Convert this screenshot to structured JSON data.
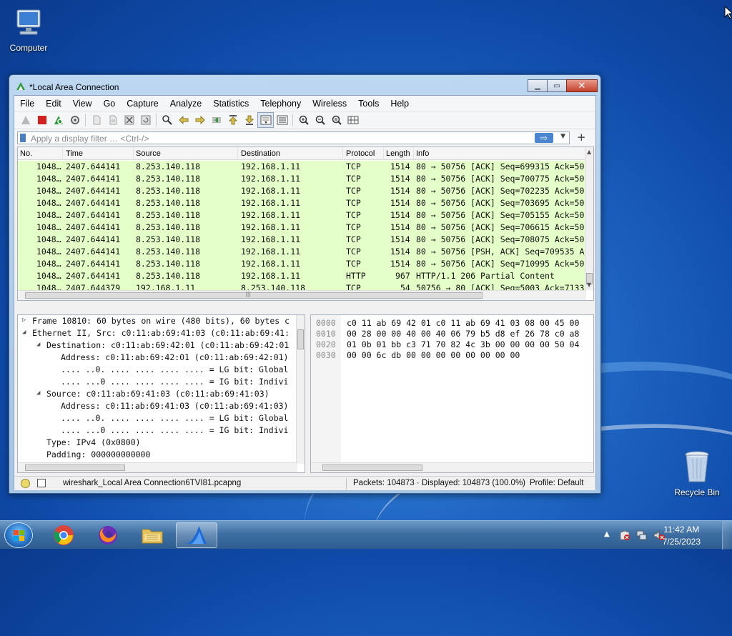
{
  "desktop": {
    "icons": [
      {
        "label": "Computer"
      },
      {
        "label": "Recycle Bin"
      }
    ]
  },
  "window": {
    "title": "*Local Area Connection",
    "menu": [
      "File",
      "Edit",
      "View",
      "Go",
      "Capture",
      "Analyze",
      "Statistics",
      "Telephony",
      "Wireless",
      "Tools",
      "Help"
    ],
    "filter_placeholder": "Apply a display filter … <Ctrl-/>",
    "columns": [
      "No.",
      "Time",
      "Source",
      "Destination",
      "Protocol",
      "Length",
      "Info"
    ],
    "packets": [
      {
        "no": "1048…",
        "time": "2407.644141",
        "src": "8.253.140.118",
        "dst": "192.168.1.11",
        "proto": "TCP",
        "len": "1514",
        "info": "80 → 50756 [ACK] Seq=699315 Ack=50"
      },
      {
        "no": "1048…",
        "time": "2407.644141",
        "src": "8.253.140.118",
        "dst": "192.168.1.11",
        "proto": "TCP",
        "len": "1514",
        "info": "80 → 50756 [ACK] Seq=700775 Ack=50"
      },
      {
        "no": "1048…",
        "time": "2407.644141",
        "src": "8.253.140.118",
        "dst": "192.168.1.11",
        "proto": "TCP",
        "len": "1514",
        "info": "80 → 50756 [ACK] Seq=702235 Ack=50"
      },
      {
        "no": "1048…",
        "time": "2407.644141",
        "src": "8.253.140.118",
        "dst": "192.168.1.11",
        "proto": "TCP",
        "len": "1514",
        "info": "80 → 50756 [ACK] Seq=703695 Ack=50"
      },
      {
        "no": "1048…",
        "time": "2407.644141",
        "src": "8.253.140.118",
        "dst": "192.168.1.11",
        "proto": "TCP",
        "len": "1514",
        "info": "80 → 50756 [ACK] Seq=705155 Ack=50"
      },
      {
        "no": "1048…",
        "time": "2407.644141",
        "src": "8.253.140.118",
        "dst": "192.168.1.11",
        "proto": "TCP",
        "len": "1514",
        "info": "80 → 50756 [ACK] Seq=706615 Ack=50"
      },
      {
        "no": "1048…",
        "time": "2407.644141",
        "src": "8.253.140.118",
        "dst": "192.168.1.11",
        "proto": "TCP",
        "len": "1514",
        "info": "80 → 50756 [ACK] Seq=708075 Ack=50"
      },
      {
        "no": "1048…",
        "time": "2407.644141",
        "src": "8.253.140.118",
        "dst": "192.168.1.11",
        "proto": "TCP",
        "len": "1514",
        "info": "80 → 50756 [PSH, ACK] Seq=709535 A"
      },
      {
        "no": "1048…",
        "time": "2407.644141",
        "src": "8.253.140.118",
        "dst": "192.168.1.11",
        "proto": "TCP",
        "len": "1514",
        "info": "80 → 50756 [ACK] Seq=710995 Ack=50"
      },
      {
        "no": "1048…",
        "time": "2407.644141",
        "src": "8.253.140.118",
        "dst": "192.168.1.11",
        "proto": "HTTP",
        "len": "967",
        "info": "HTTP/1.1 206 Partial Content"
      },
      {
        "no": "1048…",
        "time": "2407.644379",
        "src": "192.168.1.11",
        "dst": "8.253.140.118",
        "proto": "TCP",
        "len": "54",
        "info": "50756 → 80 [ACK] Seq=5003 Ack=7133"
      }
    ],
    "details": [
      {
        "tri": "▷",
        "text": "Frame 10810: 60 bytes on wire (480 bits), 60 bytes c"
      },
      {
        "tri": "◢",
        "text": "Ethernet II, Src: c0:11:ab:69:41:03 (c0:11:ab:69:41:"
      },
      {
        "tri": "◢",
        "text": "Destination: c0:11:ab:69:42:01 (c0:11:ab:69:42:01"
      },
      {
        "tri": "",
        "text": "Address: c0:11:ab:69:42:01 (c0:11:ab:69:42:01)"
      },
      {
        "tri": "",
        "text": ".... ..0. .... .... .... .... = LG bit: Global"
      },
      {
        "tri": "",
        "text": ".... ...0 .... .... .... .... = IG bit: Indivi"
      },
      {
        "tri": "◢",
        "text": "Source: c0:11:ab:69:41:03 (c0:11:ab:69:41:03)"
      },
      {
        "tri": "",
        "text": "Address: c0:11:ab:69:41:03 (c0:11:ab:69:41:03)"
      },
      {
        "tri": "",
        "text": ".... ..0. .... .... .... .... = LG bit: Global"
      },
      {
        "tri": "",
        "text": ".... ...0 .... .... .... .... = IG bit: Indivi"
      },
      {
        "tri": "",
        "text": "Type: IPv4 (0x0800)"
      },
      {
        "tri": "",
        "text": "Padding: 000000000000"
      }
    ],
    "bytes": [
      {
        "off": "0000",
        "hex": "c0 11 ab 69 42 01 c0 11  ab 69 41 03 08 00 45 00"
      },
      {
        "off": "0010",
        "hex": "00 28 00 00 40 00 40 06  79 b5 d8 ef 26 78 c0 a8"
      },
      {
        "off": "0020",
        "hex": "01 0b 01 bb c3 71 70 82  4c 3b 00 00 00 00 50 04"
      },
      {
        "off": "0030",
        "hex": "00 00 6c db 00 00 00 00  00 00 00 00"
      }
    ],
    "status": {
      "file": "wireshark_Local Area Connection6TVI81.pcapng",
      "packets": "Packets: 104873 · Displayed: 104873 (100.0%)",
      "profile": "Profile: Default"
    }
  },
  "taskbar": {
    "time": "11:42 AM",
    "date": "7/25/2023"
  },
  "colors": {
    "row_bg": "#e4ffc7",
    "accent": "#4a86d0"
  }
}
